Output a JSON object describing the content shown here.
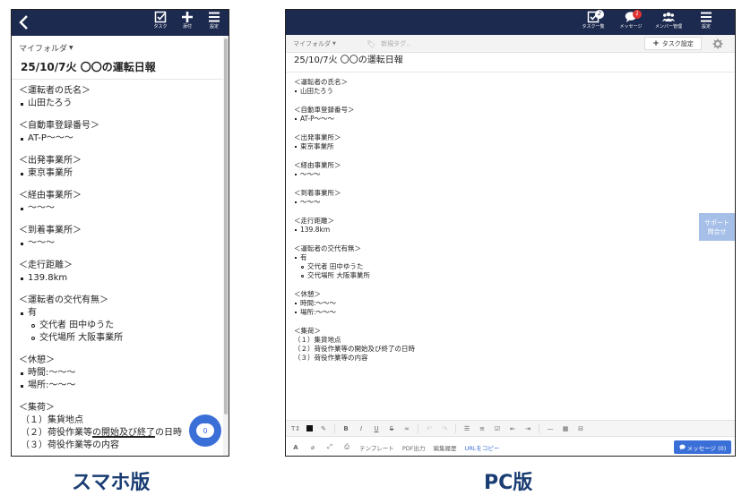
{
  "captions": {
    "mobile": "スマホ版",
    "pc": "PC版"
  },
  "colors": {
    "header": "#1c2a4f",
    "accent": "#3b6fd8",
    "badge_red": "#e03434",
    "support": "#a6bfe8"
  },
  "mobile": {
    "header": {
      "back_icon": "chevron-left-icon",
      "actions": [
        {
          "label": "タスク",
          "icon": "checkbox-icon"
        },
        {
          "label": "添付",
          "icon": "plus-icon"
        },
        {
          "label": "設定",
          "icon": "menu-icon"
        }
      ]
    },
    "folder": "マイフォルダ",
    "title": "25/10/7火 〇〇の運転日報",
    "fab_count": "0"
  },
  "pc": {
    "header": {
      "actions": [
        {
          "label": "タスク一覧",
          "icon": "checkbox-icon",
          "badge": "2"
        },
        {
          "label": "メッセージ",
          "icon": "chat-bubble-icon",
          "badge": "1"
        },
        {
          "label": "メンバー管理",
          "icon": "group-icon"
        },
        {
          "label": "設定",
          "icon": "menu-icon"
        }
      ]
    },
    "folder": "マイフォルダ",
    "tag_placeholder": "新規タグ..",
    "task_setting": "タスク設定",
    "title": "25/10/7火 〇〇の運転日報",
    "support": [
      "サポート",
      "問合せ"
    ],
    "bottom": {
      "template": "テンプレート",
      "pdf": "PDF出力",
      "history": "編集履歴",
      "copy_url": "URLをコピー",
      "message_button": "メッセージ (0)"
    }
  },
  "report": {
    "driver_h": "＜運転者の氏名＞",
    "driver": "山田たろう",
    "reg_h": "＜自動車登録番号＞",
    "reg": "AT-P〜〜〜",
    "dep_h": "＜出発事業所＞",
    "dep": "東京事業所",
    "via_h": "＜経由事業所＞",
    "via": "〜〜〜",
    "arr_h": "＜到着事業所＞",
    "arr": "〜〜〜",
    "dist_h": "＜走行距離＞",
    "dist": "139.8km",
    "swap_h": "＜運転者の交代有無＞",
    "swap": "有",
    "swap_who": "交代者 田中ゆうた",
    "swap_where": "交代場所 大阪事業所",
    "rest_h": "＜休憩＞",
    "rest_time": "時間:〜〜〜",
    "rest_place": "場所:〜〜〜",
    "cargo_h": "＜集荷＞",
    "cargo_1": "（１）集貨地点",
    "cargo_2_pre": "（２）荷役作業等",
    "cargo_2_u": "の開始及び終了",
    "cargo_2_post": "の日時",
    "cargo_2": "（２）荷役作業等の開始及び終了の日時",
    "cargo_3": "（３）荷役作業等の内容"
  }
}
